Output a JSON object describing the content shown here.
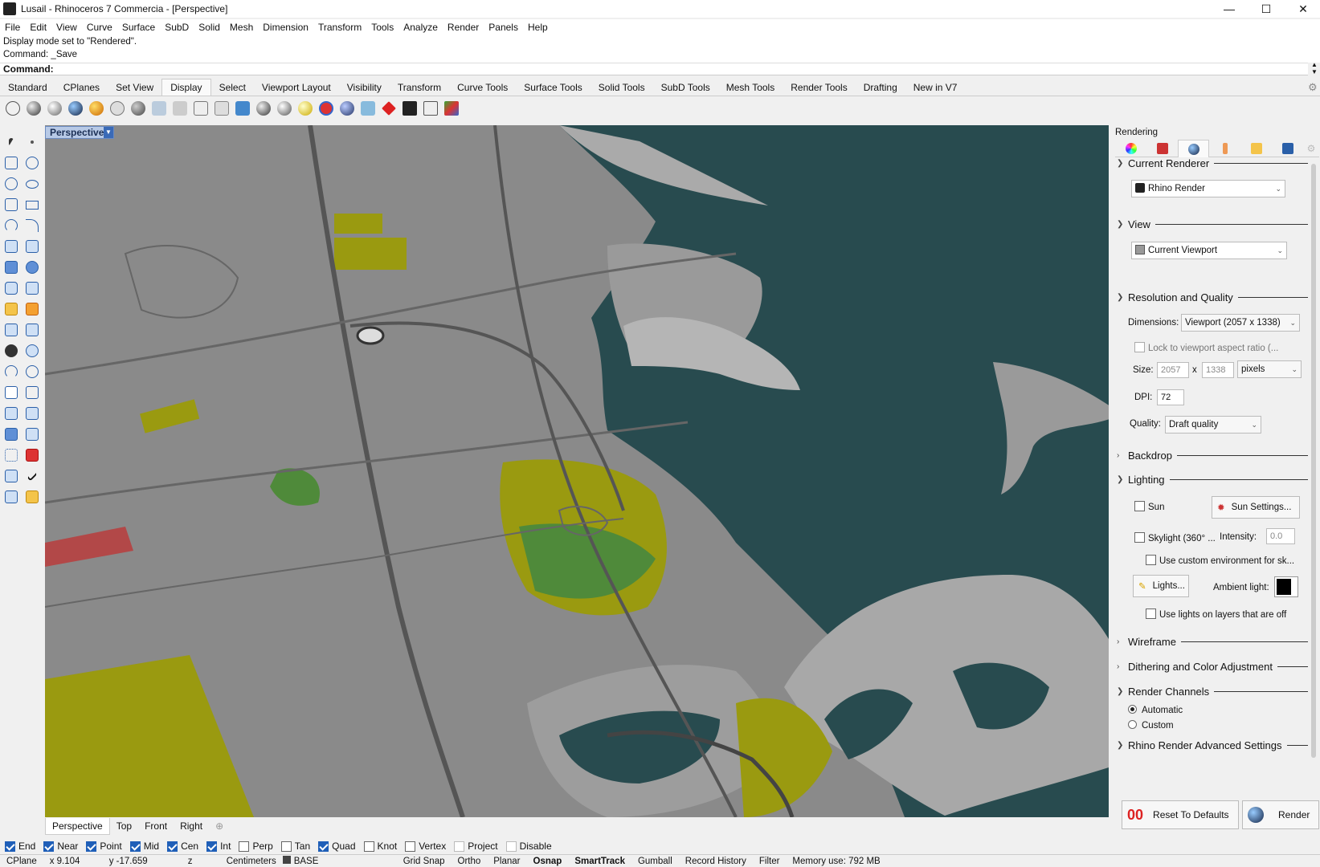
{
  "window": {
    "title": "Lusail - Rhinoceros 7 Commercia - [Perspective]",
    "minimize": "—",
    "maximize": "☐",
    "close": "✕"
  },
  "menu": [
    "File",
    "Edit",
    "View",
    "Curve",
    "Surface",
    "SubD",
    "Solid",
    "Mesh",
    "Dimension",
    "Transform",
    "Tools",
    "Analyze",
    "Render",
    "Panels",
    "Help"
  ],
  "command_history": [
    "Display mode set to \"Rendered\".",
    "Command: _Save"
  ],
  "command_prompt": "Command:",
  "toolbar_tabs": [
    "Standard",
    "CPlanes",
    "Set View",
    "Display",
    "Select",
    "Viewport Layout",
    "Visibility",
    "Transform",
    "Curve Tools",
    "Surface Tools",
    "Solid Tools",
    "SubD Tools",
    "Mesh Tools",
    "Render Tools",
    "Drafting",
    "New in V7"
  ],
  "active_toolbar_tab": "Display",
  "display_icons": [
    "wireframe-icon",
    "shaded-icon",
    "rendered-icon",
    "ghosted-icon",
    "xray-icon",
    "technical-icon",
    "artistic-icon",
    "pen-icon",
    "arctic-icon",
    "raytraced-icon",
    "monochrome-icon",
    "clipping-icon",
    "lights-icon",
    "environment-icon",
    "sun-icon",
    "grid-icon",
    "axes-icon",
    "curves-icon",
    "hide-icon",
    "monitor-icon",
    "cube-icon",
    "color-icon"
  ],
  "viewport": {
    "label": "Perspective",
    "colors": {
      "water": "#284b4f",
      "land": "#8a8a8a",
      "green": "#4f8a3a",
      "olive": "#9a9a10",
      "red": "#b24848"
    }
  },
  "viewport_tabs": [
    "Perspective",
    "Top",
    "Front",
    "Right"
  ],
  "osnaps": [
    {
      "label": "End",
      "checked": true
    },
    {
      "label": "Near",
      "checked": true
    },
    {
      "label": "Point",
      "checked": true
    },
    {
      "label": "Mid",
      "checked": true
    },
    {
      "label": "Cen",
      "checked": true
    },
    {
      "label": "Int",
      "checked": true
    },
    {
      "label": "Perp",
      "checked": false
    },
    {
      "label": "Tan",
      "checked": false
    },
    {
      "label": "Quad",
      "checked": true
    },
    {
      "label": "Knot",
      "checked": false
    },
    {
      "label": "Vertex",
      "checked": false
    },
    {
      "label": "Project",
      "checked": false
    },
    {
      "label": "Disable",
      "checked": false
    }
  ],
  "status": {
    "cplane": "CPlane",
    "x": "x 9.104",
    "y": "y -17.659",
    "z": "z",
    "units": "Centimeters",
    "layer": "BASE",
    "grid_snap": "Grid Snap",
    "ortho": "Ortho",
    "planar": "Planar",
    "osnap": "Osnap",
    "smarttrack": "SmartTrack",
    "gumball": "Gumball",
    "record_history": "Record History",
    "filter": "Filter",
    "memory": "Memory use: 792 MB"
  },
  "panel": {
    "title": "Rendering",
    "current_renderer": {
      "heading": "Current Renderer",
      "value": "Rhino Render"
    },
    "view": {
      "heading": "View",
      "value": "Current Viewport"
    },
    "resolution": {
      "heading": "Resolution and Quality",
      "dimensions_label": "Dimensions:",
      "dimensions_value": "Viewport (2057 x 1338)",
      "lock_label": "Lock to viewport aspect ratio (...",
      "size_label": "Size:",
      "width": "2057",
      "x": "x",
      "height": "1338",
      "units": "pixels",
      "dpi_label": "DPI:",
      "dpi": "72",
      "quality_label": "Quality:",
      "quality": "Draft quality"
    },
    "backdrop": "Backdrop",
    "lighting": {
      "heading": "Lighting",
      "sun": "Sun",
      "sun_settings": "Sun Settings...",
      "skylight": "Skylight (360° ...",
      "intensity_label": "Intensity:",
      "intensity": "0.0",
      "custom_env": "Use custom environment for sk...",
      "lights": "Lights...",
      "ambient_label": "Ambient light:",
      "lights_off": "Use lights on layers that are off"
    },
    "wireframe": "Wireframe",
    "dithering": "Dithering and Color Adjustment",
    "render_channels": {
      "heading": "Render Channels",
      "automatic": "Automatic",
      "custom": "Custom"
    },
    "advanced": "Rhino Render Advanced Settings",
    "reset": "Reset To Defaults",
    "render": "Render"
  }
}
